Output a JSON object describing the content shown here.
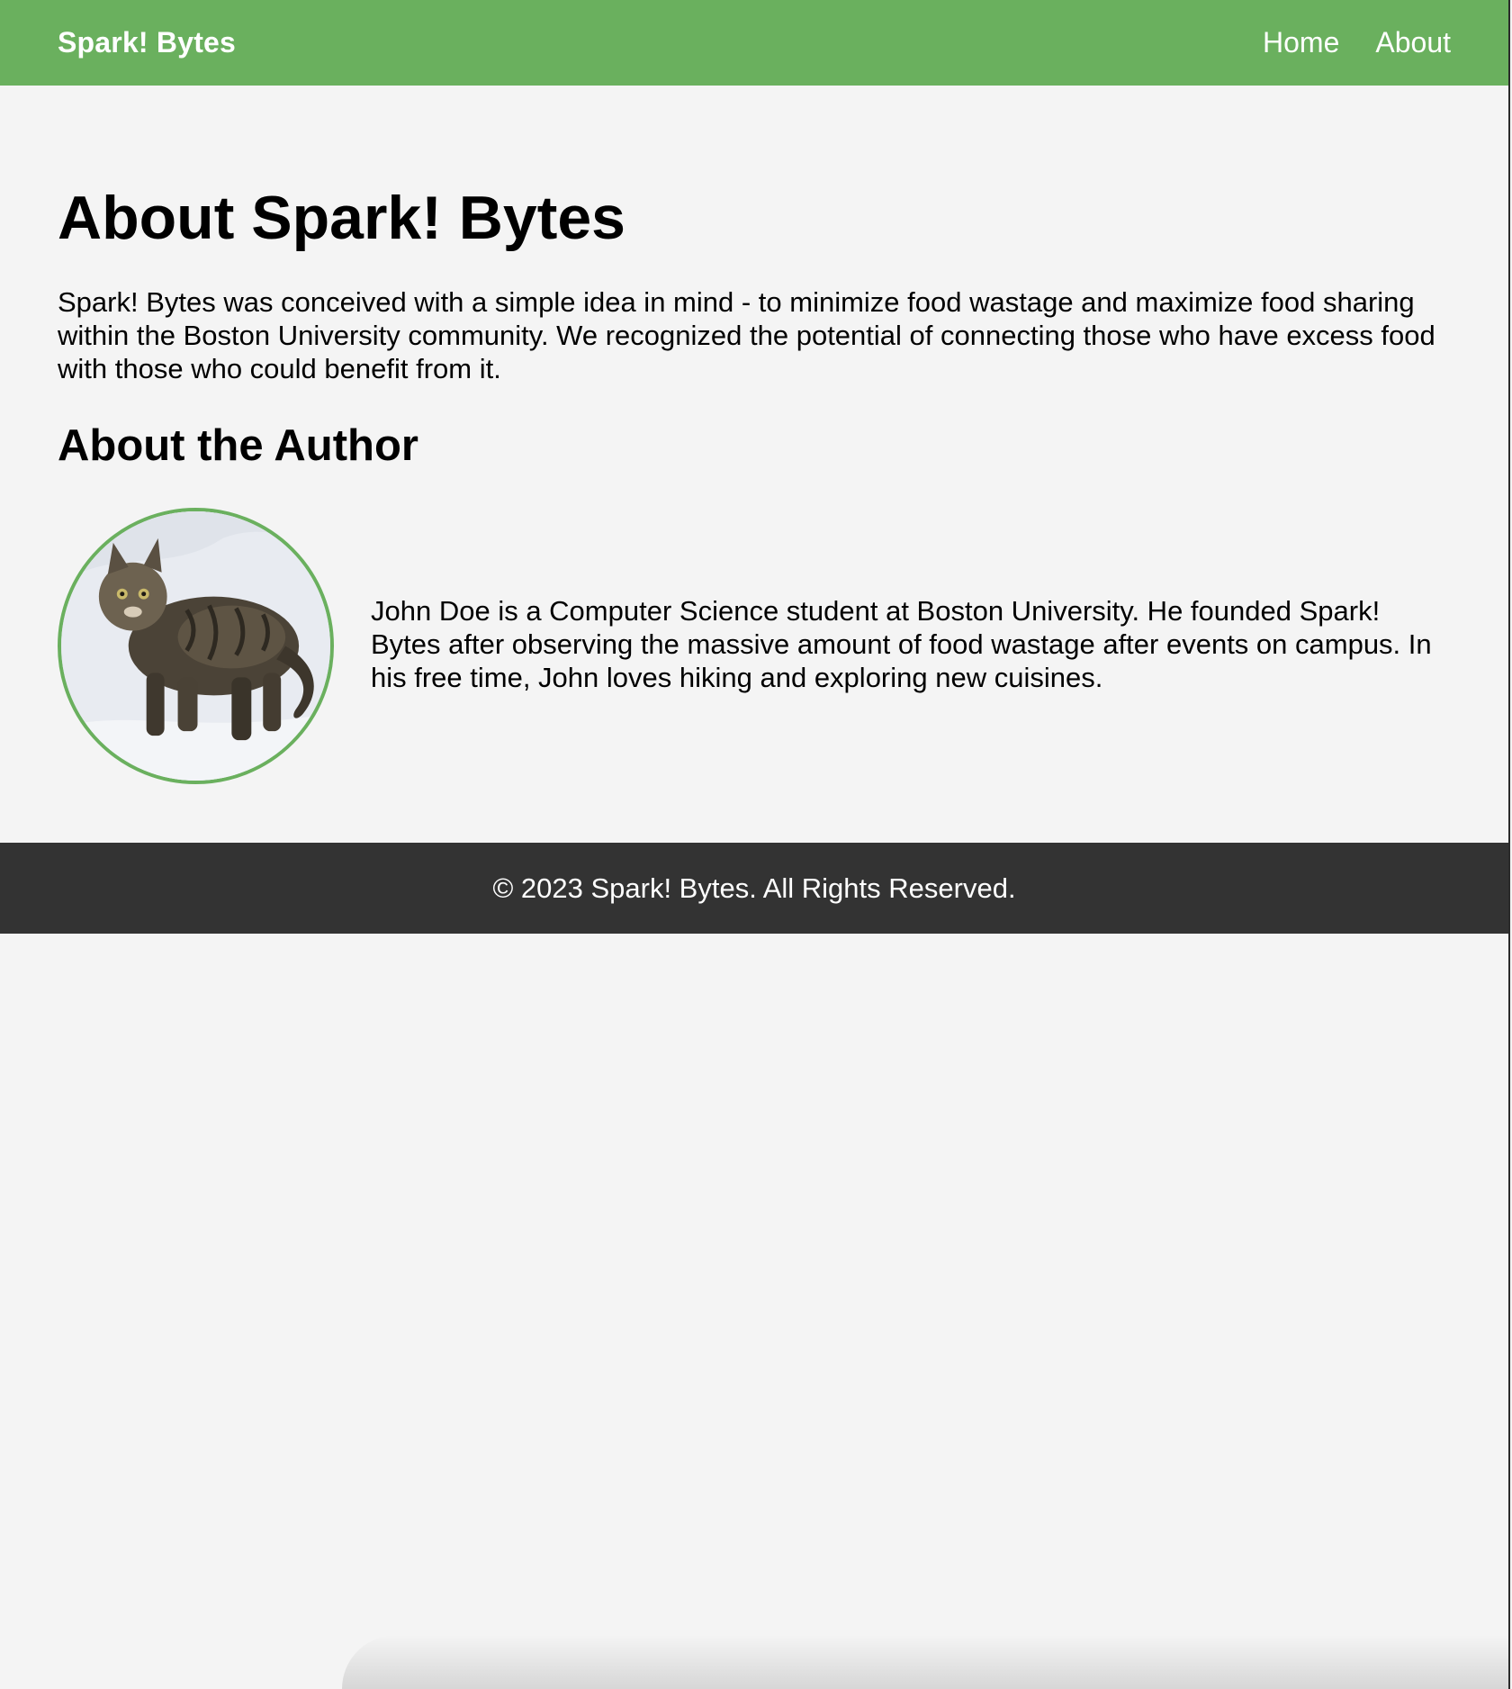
{
  "navbar": {
    "brand": "Spark! Bytes",
    "links": [
      {
        "label": "Home"
      },
      {
        "label": "About"
      }
    ],
    "color": "#6ab05e"
  },
  "main": {
    "title": "About Spark! Bytes",
    "intro": "Spark! Bytes was conceived with a simple idea in mind - to minimize food wastage and maximize food sharing within the Boston University community. We recognized the potential of connecting those who have excess food with those who could benefit from it.",
    "author_heading": "About the Author",
    "author_photo_icon": "cat-photo",
    "author_bio": "John Doe is a Computer Science student at Boston University. He founded Spark! Bytes after observing the massive amount of food wastage after events on campus. In his free time, John loves hiking and exploring new cuisines."
  },
  "footer": {
    "text": "© 2023 Spark! Bytes. All Rights Reserved.",
    "color": "#333333"
  }
}
